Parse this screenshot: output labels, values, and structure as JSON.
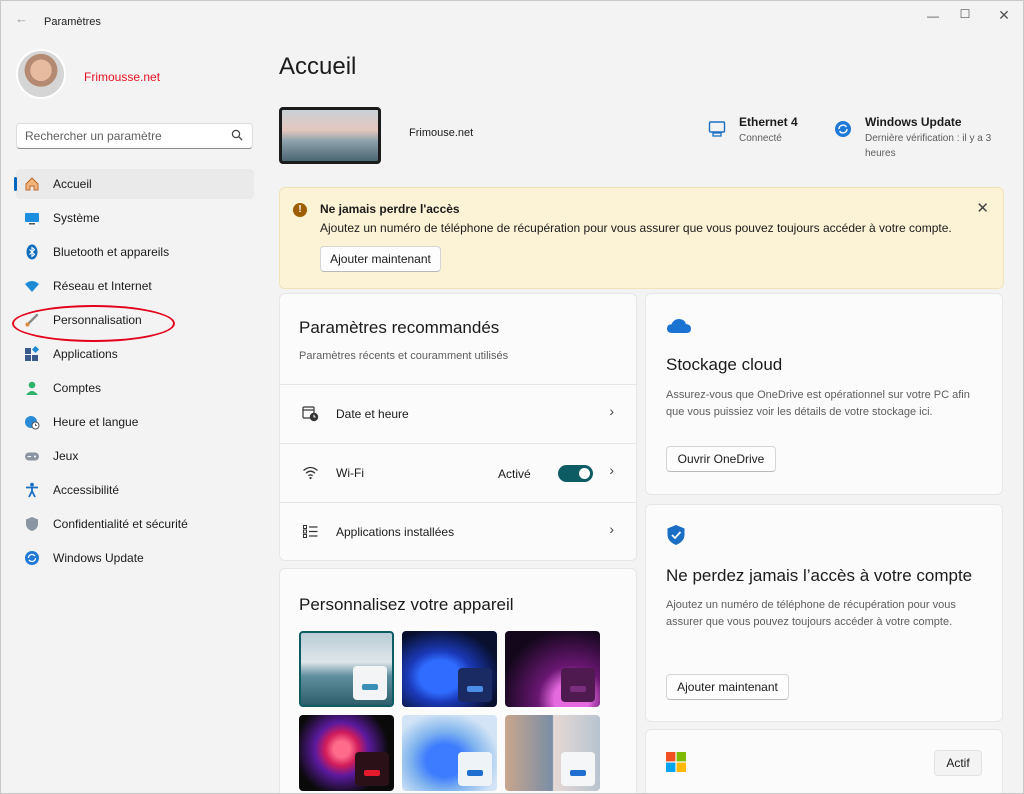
{
  "app": {
    "title": "Paramètres"
  },
  "user": {
    "name": "Frimousse.net"
  },
  "search": {
    "placeholder": "Rechercher un paramètre"
  },
  "nav": {
    "items": [
      {
        "label": "Accueil",
        "icon": "home-icon"
      },
      {
        "label": "Système",
        "icon": "system-icon"
      },
      {
        "label": "Bluetooth et appareils",
        "icon": "bluetooth-icon"
      },
      {
        "label": "Réseau et Internet",
        "icon": "wifi-icon"
      },
      {
        "label": "Personnalisation",
        "icon": "brush-icon"
      },
      {
        "label": "Applications",
        "icon": "apps-icon"
      },
      {
        "label": "Comptes",
        "icon": "account-icon"
      },
      {
        "label": "Heure et langue",
        "icon": "globe-clock-icon"
      },
      {
        "label": "Jeux",
        "icon": "gamepad-icon"
      },
      {
        "label": "Accessibilité",
        "icon": "accessibility-icon"
      },
      {
        "label": "Confidentialité et sécurité",
        "icon": "shield-icon"
      },
      {
        "label": "Windows Update",
        "icon": "update-icon"
      }
    ]
  },
  "main": {
    "title": "Accueil",
    "device_name": "Frimouse.net",
    "network": {
      "title": "Ethernet 4",
      "status": "Connecté"
    },
    "update": {
      "title": "Windows Update",
      "status": "Dernière vérification : il y a 3 heures"
    }
  },
  "banner": {
    "title": "Ne jamais perdre l'accès",
    "text": "Ajoutez un numéro de téléphone de récupération pour vous assurer que vous pouvez toujours accéder à votre compte.",
    "button": "Ajouter maintenant"
  },
  "recommended": {
    "title": "Paramètres recommandés",
    "subtitle": "Paramètres récents et couramment utilisés",
    "rows": [
      {
        "label": "Date et heure"
      },
      {
        "label": "Wi-Fi",
        "state": "Activé"
      },
      {
        "label": "Applications installées"
      }
    ]
  },
  "personalize": {
    "title": "Personnalisez votre appareil"
  },
  "cloud": {
    "title": "Stockage cloud",
    "text": "Assurez-vous que OneDrive est opérationnel sur votre PC afin que vous puissiez voir les détails de votre stockage ici.",
    "button": "Ouvrir OneDrive"
  },
  "account": {
    "title": "Ne perdez jamais l’accès à votre compte",
    "text": "Ajoutez un numéro de téléphone de récupération pour vous assurer que vous pouvez toujours accéder à votre compte.",
    "button": "Ajouter maintenant"
  },
  "microsoft": {
    "badge": "Actif"
  },
  "colors": {
    "accent": "#0067c0",
    "warning_bg": "#fcf3d6",
    "annotation": "#e3001b"
  }
}
